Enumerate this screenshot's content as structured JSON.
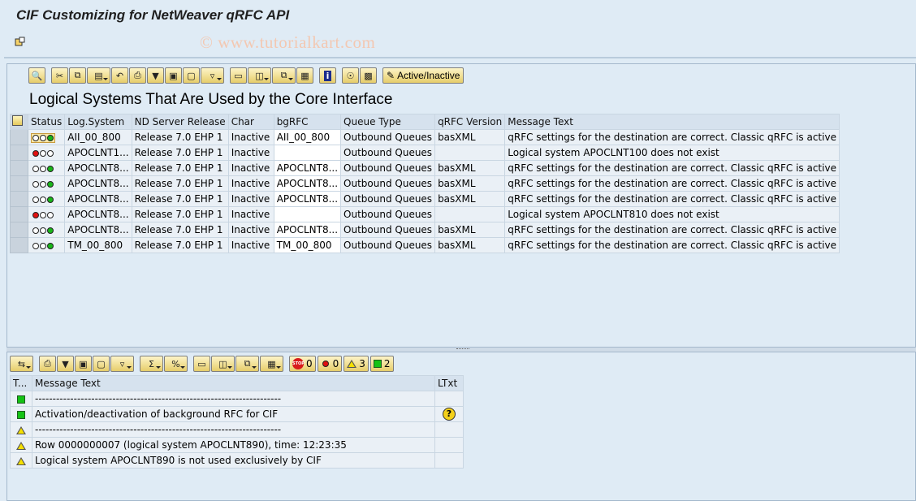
{
  "window": {
    "title": "CIF Customizing for NetWeaver qRFC API",
    "watermark": "© www.tutorialkart.com"
  },
  "toolbar_top": {
    "active_inactive_label": "Active/Inactive"
  },
  "main": {
    "heading": "Logical Systems That Are Used by the Core Interface",
    "columns": [
      "Status",
      "Log.System",
      "ND Server Release",
      "Char",
      "bgRFC",
      "Queue Type",
      "qRFC Version",
      "Message Text"
    ],
    "rows": [
      {
        "status": "yellow-green",
        "log_system": "AII_00_800",
        "release": "Release 7.0 EHP 1",
        "char": "Inactive",
        "bgrfc": "AII_00_800",
        "queue_type": "Outbound Queues",
        "qrfc": "basXML",
        "message": "qRFC settings for the destination are correct. Classic qRFC is active"
      },
      {
        "status": "red",
        "log_system": "APOCLNT1...",
        "release": "Release 7.0 EHP 1",
        "char": "Inactive",
        "bgrfc": "",
        "queue_type": "Outbound Queues",
        "qrfc": "",
        "message": "Logical system APOCLNT100 does not exist"
      },
      {
        "status": "green",
        "log_system": "APOCLNT8...",
        "release": "Release 7.0 EHP 1",
        "char": "Inactive",
        "bgrfc": "APOCLNT8...",
        "queue_type": "Outbound Queues",
        "qrfc": "basXML",
        "message": "qRFC settings for the destination are correct. Classic qRFC is active"
      },
      {
        "status": "green",
        "log_system": "APOCLNT8...",
        "release": "Release 7.0 EHP 1",
        "char": "Inactive",
        "bgrfc": "APOCLNT8...",
        "queue_type": "Outbound Queues",
        "qrfc": "basXML",
        "message": "qRFC settings for the destination are correct. Classic qRFC is active"
      },
      {
        "status": "green",
        "log_system": "APOCLNT8...",
        "release": "Release 7.0 EHP 1",
        "char": "Inactive",
        "bgrfc": "APOCLNT8...",
        "queue_type": "Outbound Queues",
        "qrfc": "basXML",
        "message": "qRFC settings for the destination are correct. Classic qRFC is active"
      },
      {
        "status": "red",
        "log_system": "APOCLNT8...",
        "release": "Release 7.0 EHP 1",
        "char": "Inactive",
        "bgrfc": "",
        "queue_type": "Outbound Queues",
        "qrfc": "",
        "message": "Logical system APOCLNT810 does not exist"
      },
      {
        "status": "green",
        "log_system": "APOCLNT8...",
        "release": "Release 7.0 EHP 1",
        "char": "Inactive",
        "bgrfc": "APOCLNT8...",
        "queue_type": "Outbound Queues",
        "qrfc": "basXML",
        "message": "qRFC settings for the destination are correct. Classic qRFC is active"
      },
      {
        "status": "green",
        "log_system": "TM_00_800",
        "release": "Release 7.0 EHP 1",
        "char": "Inactive",
        "bgrfc": "TM_00_800",
        "queue_type": "Outbound Queues",
        "qrfc": "basXML",
        "message": "qRFC settings for the destination are correct. Classic qRFC is active"
      }
    ]
  },
  "log": {
    "counters": {
      "stop": "0",
      "error": "0",
      "warning": "3",
      "success": "2"
    },
    "columns": [
      "T...",
      "Message Text",
      "LTxt"
    ],
    "rows": [
      {
        "type": "success",
        "message": "----------------------------------------------------------------------",
        "ltxt": false
      },
      {
        "type": "success",
        "message": "Activation/deactivation of background RFC for CIF",
        "ltxt": true
      },
      {
        "type": "warning",
        "message": "----------------------------------------------------------------------",
        "ltxt": false
      },
      {
        "type": "warning",
        "message": "Row 0000000007 (logical system APOCLNT890), time: 12:23:35",
        "ltxt": false
      },
      {
        "type": "warning",
        "message": "Logical system APOCLNT890 is not used exclusively by CIF",
        "ltxt": false
      }
    ]
  }
}
